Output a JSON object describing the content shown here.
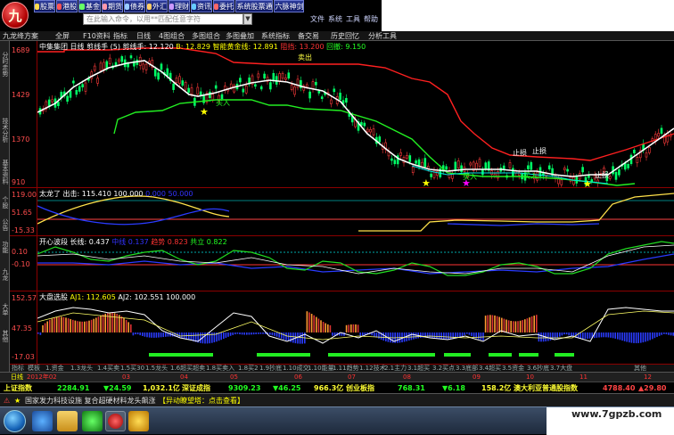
{
  "toolbar": {
    "logo_char": "九",
    "buttons": [
      "股票",
      "港股",
      "基金",
      "期货",
      "债券",
      "外汇",
      "理财",
      "资讯",
      "委托",
      "系统股票通",
      "六脉神剑"
    ],
    "search_placeholder": "在此输入命令，以用**匹配任意字符",
    "menu_right": [
      "文件",
      "系统",
      "工具",
      "帮助"
    ]
  },
  "strip": {
    "items": [
      "九龙绛方案",
      "全屏",
      "F10资料",
      "指标",
      "日线",
      "4图组合",
      "多图组合",
      "多图叠加",
      "系统指标",
      "备交易",
      "历史回忆",
      "分析工具"
    ]
  },
  "side_tabs": [
    "分时走势",
    "技术分析",
    "基本资料",
    "个股",
    "公告",
    "功能",
    "九龙",
    "大单",
    "其他"
  ],
  "main_pane": {
    "stock": "中集集团 日线",
    "ind1_label": "剪线手 (5)",
    "ind1_value": "剪线手: 12.120",
    "b_value": "B: 12.829",
    "gold_label": "智能黄金线: 12.891",
    "resist_label": "阻挡: 13.200",
    "support_label": "回撤: 9.150",
    "y_ticks": [
      "1689",
      "1429",
      "1370",
      "910"
    ],
    "buy_labels": [
      "买入",
      "买入",
      "买入"
    ],
    "sell_labels": [
      "卖出",
      "止损",
      "止损",
      "止损"
    ]
  },
  "pane2": {
    "title": "太龙了 出击: 115.410",
    "values": [
      "100.000",
      "0.000",
      "50.000"
    ],
    "y_ticks": [
      "119.00",
      "51.65",
      "-15.33"
    ]
  },
  "pane3": {
    "title": "开心波段 长线: 0.437",
    "values": [
      "0.137",
      "0.823",
      "0.822"
    ],
    "labels": [
      "中线",
      "趋势",
      "共立"
    ],
    "y_ticks": [
      "0.10",
      "-0.10"
    ]
  },
  "pane4": {
    "title": "大盘选股",
    "a1": "AJ1: 112.605",
    "a2": "AJ2: 102.551",
    "a3": "100.000",
    "y_ticks": [
      "152.57",
      "47.35",
      "-17.03"
    ]
  },
  "date_axis": {
    "labels": [
      "2012年02",
      "03",
      "04",
      "05",
      "06",
      "07",
      "08",
      "09",
      "10",
      "11",
      "12",
      "2013/01"
    ]
  },
  "bottom_tabs": [
    "指标",
    "模板",
    "1.资金",
    "1.3龙头",
    "1.4买卖",
    "1.5买30",
    "1.5龙头",
    "1.6超买超卖",
    "1.8买卖入",
    "1.8买2",
    "1.9抄底",
    "1.10成交",
    "1.10能量",
    "1.11趋势",
    "1.12技术",
    "2.1主力",
    "3.1超买",
    "3.2买点",
    "3.3底部",
    "3.4超买",
    "3.5资金",
    "3.6抄底",
    "3.7大盘",
    "其他"
  ],
  "tabstrip": [
    "日线",
    "周线",
    "月线",
    "分钟",
    "5分",
    "15分",
    "30分",
    "60分",
    "多日",
    "季线",
    "年线"
  ],
  "index_bar": {
    "sh_name": "上证指数",
    "sh_val": "2284.91",
    "sh_chg": "▼24.59",
    "sh_amt": "1,032.1亿",
    "sz_name": "深证成指",
    "sz_val": "9309.23",
    "sz_chg": "▼46.25",
    "sz_amt": "966.3亿",
    "cy_name": "创业板指",
    "cy_val": "768.31",
    "cy_chg": "▼6.18",
    "cy_amt": "158.2亿",
    "au_name": "澳大利亚普通股指数",
    "au_val": "4788.40",
    "au_chg": "▲29.80"
  },
  "news": {
    "prefix": "★",
    "text": "国家发力科技设施 复合超硬材料龙头飙涨",
    "tag": "【异动瞭望塔：点击查看】"
  },
  "watermark": "www.7gpzb.com",
  "colors": {
    "up": "#ff3b3b",
    "down": "#00ff66",
    "white_line": "#ffffff",
    "gold": "#ffff00",
    "red_line": "#ff2020",
    "green_line": "#22ee22",
    "blue": "#2a3bff",
    "cyan": "#00e5e5",
    "orange": "#ff9a30"
  }
}
